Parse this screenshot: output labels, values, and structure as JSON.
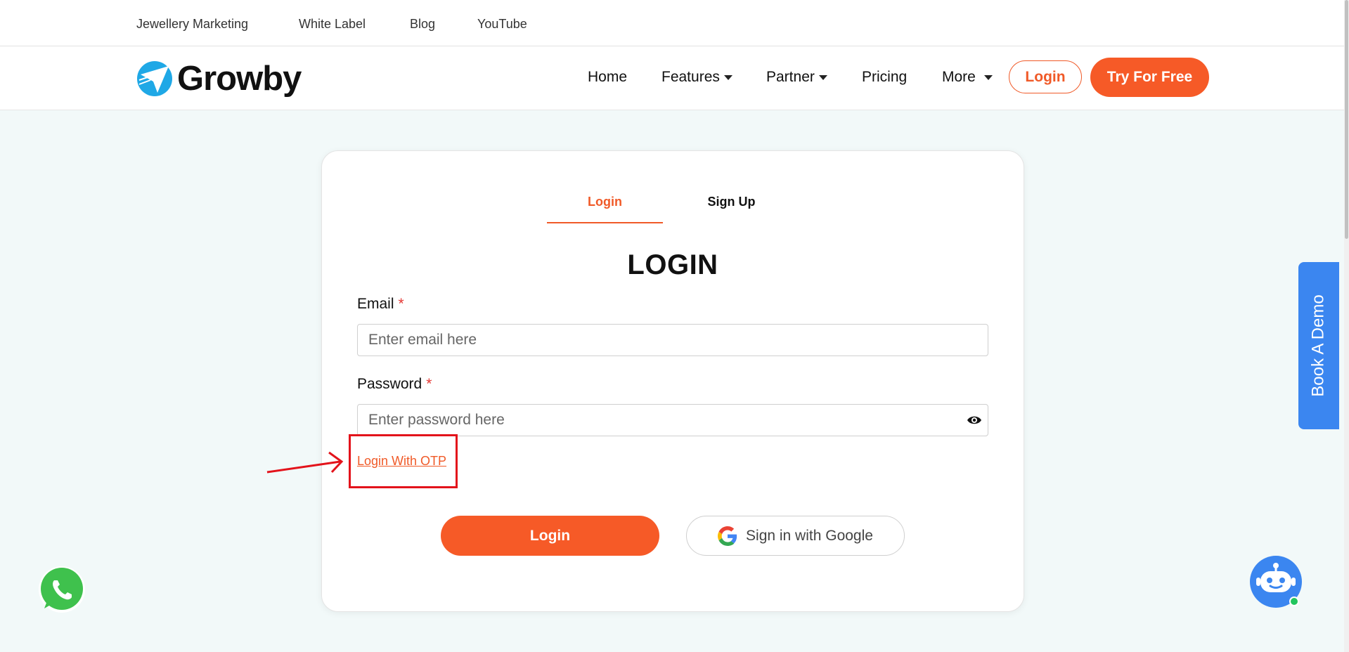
{
  "topbar": {
    "links": [
      "Jewellery Marketing",
      "White Label",
      "Blog",
      "YouTube"
    ]
  },
  "navbar": {
    "brand": "Growby",
    "items": [
      {
        "label": "Home",
        "dropdown": false
      },
      {
        "label": "Features",
        "dropdown": true
      },
      {
        "label": "Partner",
        "dropdown": true
      },
      {
        "label": "Pricing",
        "dropdown": false
      },
      {
        "label": "More",
        "dropdown": true
      }
    ],
    "login_label": "Login",
    "cta_label": "Try For Free"
  },
  "auth": {
    "tabs": [
      {
        "label": "Login",
        "active": true
      },
      {
        "label": "Sign Up",
        "active": false
      }
    ],
    "heading": "LOGIN",
    "email": {
      "label": "Email",
      "required_mark": "*",
      "placeholder": "Enter email here",
      "value": ""
    },
    "password": {
      "label": "Password",
      "required_mark": "*",
      "placeholder": "Enter password here",
      "value": ""
    },
    "otp_link": "Login With OTP",
    "submit_label": "Login",
    "google_label": "Sign in with Google"
  },
  "side": {
    "demo_label": "Book A Demo"
  },
  "colors": {
    "accent": "#f65a27",
    "demo_blue": "#3b86f0",
    "annotation_red": "#e3131b",
    "background": "#f2f9f9"
  },
  "icons": [
    "growby-logo-icon",
    "caret-down-icon",
    "eye-icon",
    "google-icon",
    "whatsapp-icon",
    "chatbot-icon",
    "annotation-arrow"
  ]
}
